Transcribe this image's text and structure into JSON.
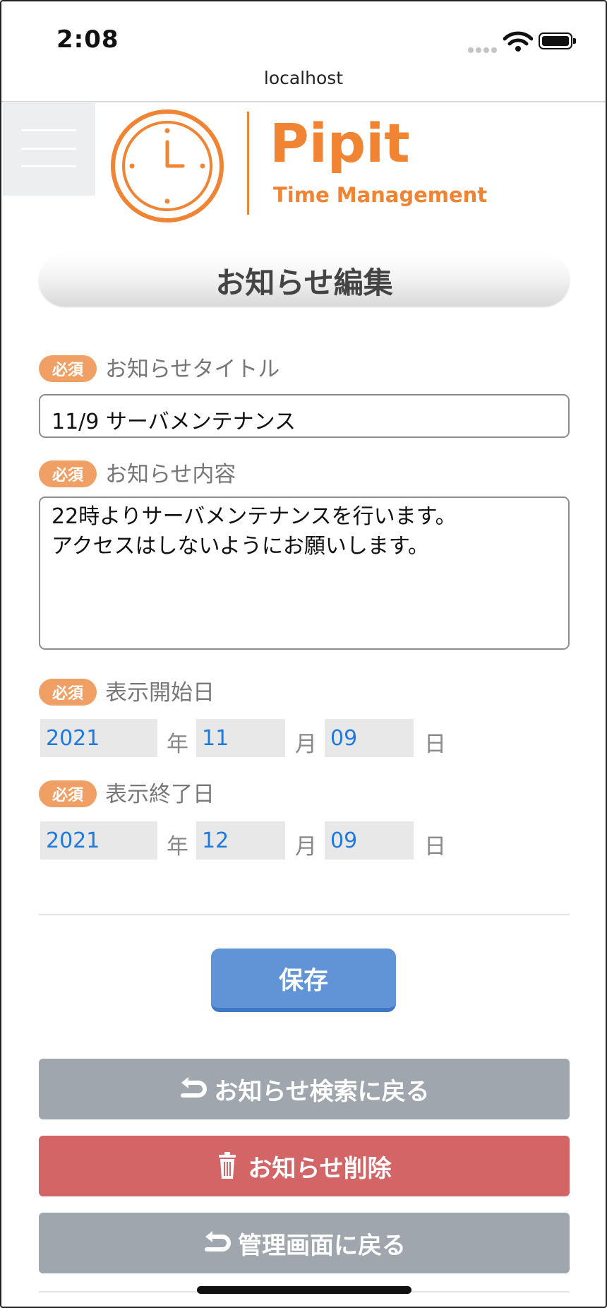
{
  "status_bar": {
    "time": "2:08",
    "url": "localhost"
  },
  "header": {
    "brand": "Pipit",
    "tagline": "Time Management"
  },
  "page": {
    "title": "お知らせ編集"
  },
  "form": {
    "required_badge": "必須",
    "notice_title": {
      "label": "お知らせタイトル",
      "value": "11/9 サーバメンテナンス"
    },
    "notice_content": {
      "label": "お知らせ内容",
      "lines": [
        "22時よりサーバメンテナンスを行います。",
        "アクセスはしないようにお願いします。"
      ]
    },
    "start_date": {
      "label": "表示開始日",
      "year": "2021",
      "month": "11",
      "day": "09"
    },
    "end_date": {
      "label": "表示終了日",
      "year": "2021",
      "month": "12",
      "day": "09"
    },
    "units": {
      "year": "年",
      "month": "月",
      "day": "日"
    }
  },
  "buttons": {
    "save": "保存",
    "back_to_search": "お知らせ検索に戻る",
    "delete": "お知らせ削除",
    "back_to_admin": "管理画面に戻る"
  },
  "colors": {
    "brand_orange": "#f08432",
    "badge": "#f0a064",
    "save": "#6194d6",
    "delete": "#d36566",
    "secondary": "#9fa6ad",
    "date_value": "#1f7ae0"
  }
}
